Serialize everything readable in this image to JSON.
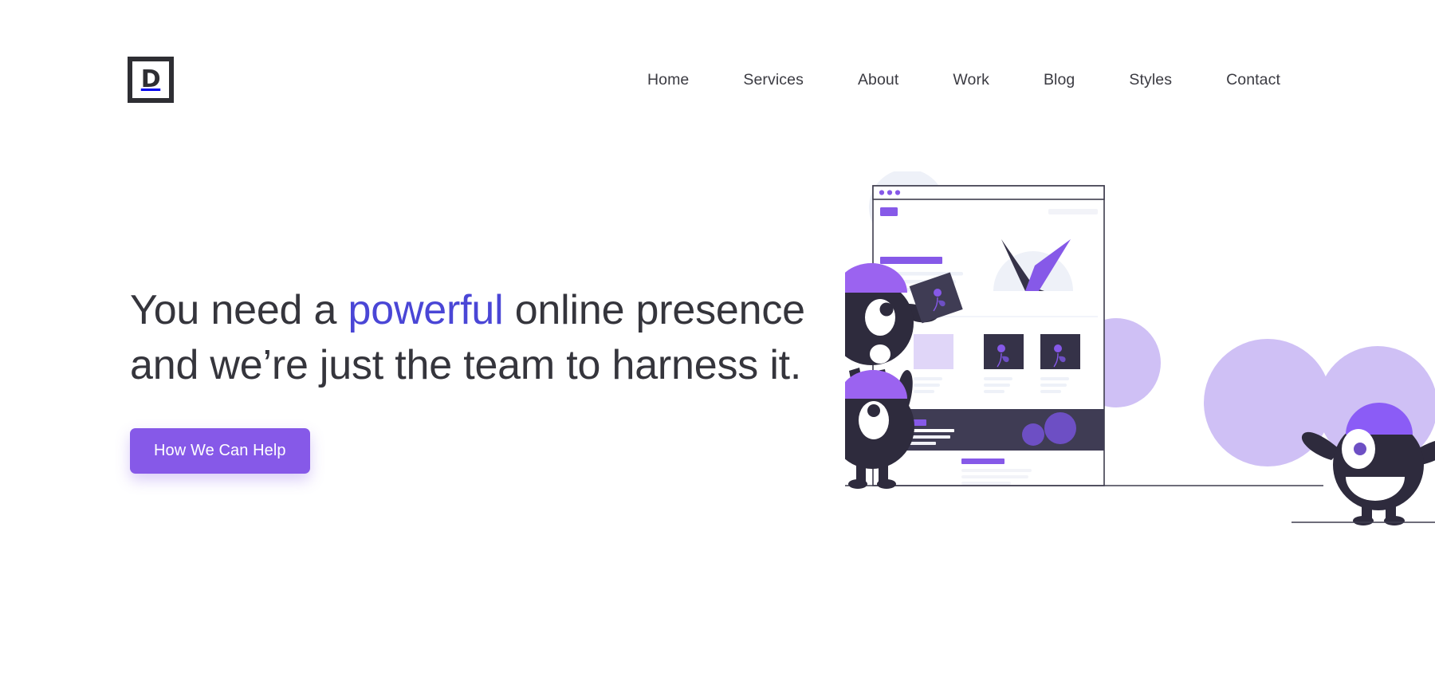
{
  "brand": {
    "logo_letter": "D",
    "logo_name": "D logomark"
  },
  "nav": {
    "items": [
      {
        "label": "Home"
      },
      {
        "label": "Services"
      },
      {
        "label": "About"
      },
      {
        "label": "Work"
      },
      {
        "label": "Blog"
      },
      {
        "label": "Styles"
      },
      {
        "label": "Contact"
      }
    ]
  },
  "hero": {
    "headline_part1": "You need a ",
    "headline_accent": "powerful",
    "headline_part2": " online presence\nand we’re just the team to harness it.",
    "cta_label": "How We Can Help"
  },
  "colors": {
    "accent_purple": "#8659E8",
    "accent_blue": "#4a46d6",
    "dark": "#2e2e33",
    "dark_navy": "#353248",
    "lavender": "#cfc0f5",
    "pale_lavender": "#eae4fb",
    "pale_blue": "#eef1f8",
    "page_background": "#ffffff",
    "text": "#35353c"
  },
  "illustration": {
    "name": "team-building-website-illustration",
    "browser_mockup": {
      "dot_count": 3,
      "card_count": 3
    },
    "characters": [
      {
        "name": "character-holding-card"
      },
      {
        "name": "character-arms-up"
      },
      {
        "name": "character-smiling"
      }
    ]
  }
}
